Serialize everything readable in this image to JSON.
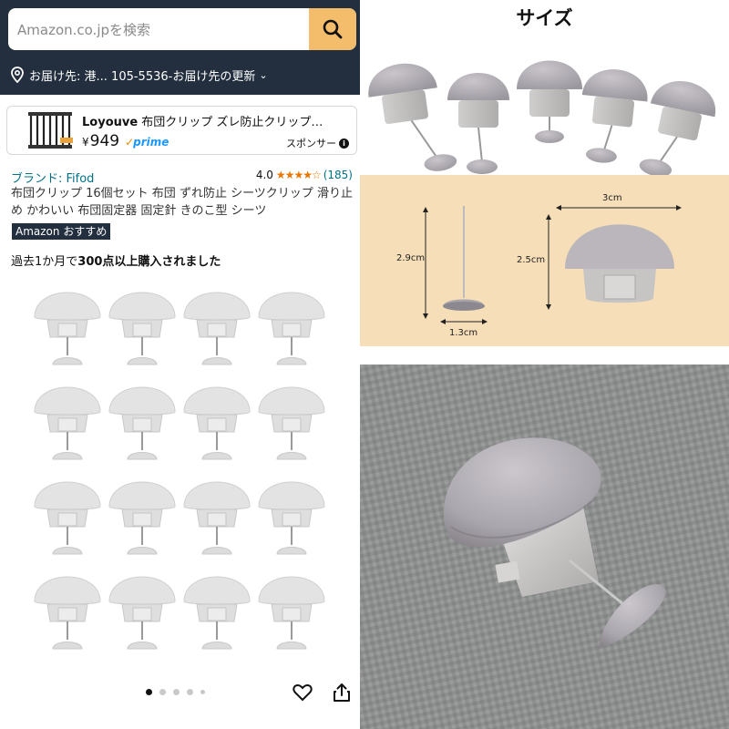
{
  "search": {
    "placeholder": "Amazon.co.jpを検索"
  },
  "delivery": {
    "text": "お届け先: 港... 105-5536‐お届け先の更新"
  },
  "sponsored": {
    "brand": "Loyouve",
    "title": " 布団クリップ ズレ防止クリップ…",
    "currency": "¥",
    "price": "949",
    "prime": "prime",
    "label": "スポンサー",
    "info": "i"
  },
  "product": {
    "brand_label": "ブランド: Fifod",
    "rating": "4.0",
    "stars": "★★★★☆",
    "review_count": "(185)",
    "title": "布団クリップ 16個セット 布団 ずれ防止 シーツクリップ 滑り止め かわいい 布団固定器 固定針 きのこ型 シーツ",
    "badge_brand": "Amazon",
    "badge_text": "おすすめ",
    "bought_prefix": "過去1か月で",
    "bought_bold": "300点以上購入されました"
  },
  "gallery": {
    "count": 16,
    "dots": 5,
    "active_dot": 0
  },
  "size_panel": {
    "title": "サイズ",
    "dims": {
      "pin_height": "2.9cm",
      "pin_base": "1.3cm",
      "cap_width": "3cm",
      "cap_height": "2.5cm"
    }
  },
  "colors": {
    "header": "#232f3e",
    "search_button": "#f3bd6b",
    "link": "#007185",
    "star": "#e77600",
    "prime": "#1a98ff",
    "dim_bg": "#f6deb8",
    "clip_gray": "#b9b5bb"
  },
  "icons": [
    "search-icon",
    "location-pin-icon",
    "chevron-down-icon",
    "info-icon",
    "heart-icon",
    "share-icon"
  ]
}
